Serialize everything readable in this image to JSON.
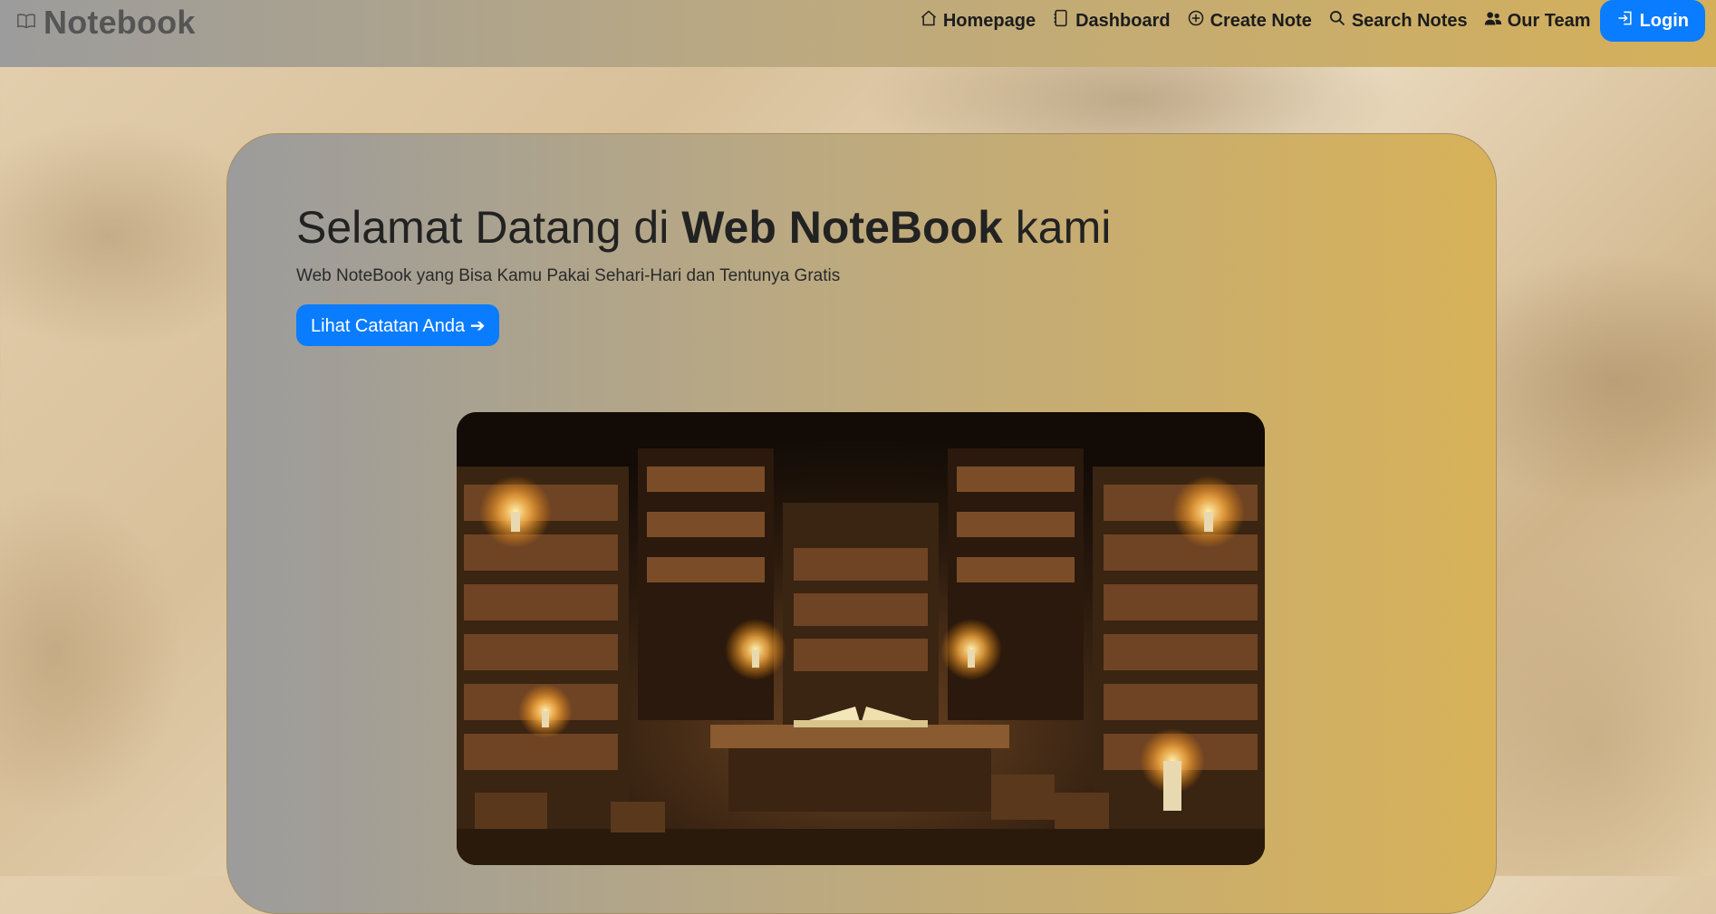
{
  "brand": {
    "name": "Notebook",
    "icon": "book-icon"
  },
  "nav": {
    "items": [
      {
        "label": "Homepage",
        "icon": "home-icon"
      },
      {
        "label": "Dashboard",
        "icon": "journal-icon"
      },
      {
        "label": "Create Note",
        "icon": "plus-circle-icon"
      },
      {
        "label": "Search Notes",
        "icon": "search-icon"
      },
      {
        "label": "Our Team",
        "icon": "people-icon"
      }
    ],
    "login": {
      "label": "Login",
      "icon": "login-icon"
    }
  },
  "hero": {
    "title_prefix": "Selamat Datang di ",
    "title_bold": "Web NoteBook",
    "title_suffix": " kami",
    "subtitle": "Web NoteBook yang Bisa Kamu Pakai Sehari-Hari dan Tentunya Gratis",
    "cta_label": "Lihat Catatan Anda ➔"
  },
  "colors": {
    "accent": "#0a7cff",
    "navbar_start": "#9c9c9c",
    "navbar_end": "#d4b05a"
  }
}
